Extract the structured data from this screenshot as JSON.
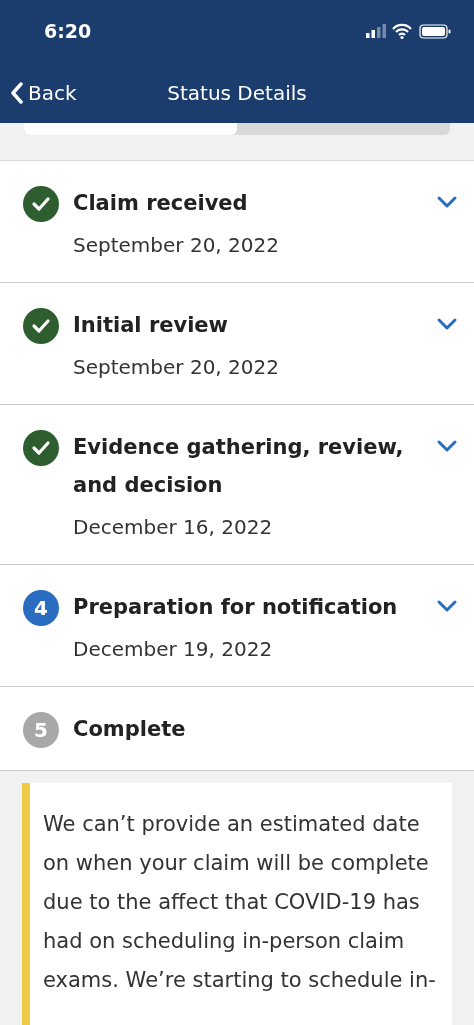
{
  "status_bar": {
    "time": "6:20"
  },
  "nav": {
    "back": "Back",
    "title": "Status Details"
  },
  "progress": {
    "level": 0.5
  },
  "steps": [
    {
      "kind": "done",
      "title": "Claim received",
      "date": "September 20, 2022",
      "expandable": true
    },
    {
      "kind": "done",
      "title": "Initial review",
      "date": "September 20, 2022",
      "expandable": true
    },
    {
      "kind": "done",
      "title": "Evidence gathering, review, and decision",
      "date": "December 16, 2022",
      "expandable": true
    },
    {
      "kind": "current",
      "marker": "4",
      "title": "Preparation for notification",
      "date": "December 19, 2022",
      "expandable": true
    },
    {
      "kind": "upcoming",
      "marker": "5",
      "title": "Complete",
      "expandable": false
    }
  ],
  "notice": {
    "text": "We can’t provide an estimated date on when your claim will be complete due to the affect that COVID-19 has had on scheduling in-person claim exams. We’re starting to schedule in-"
  }
}
